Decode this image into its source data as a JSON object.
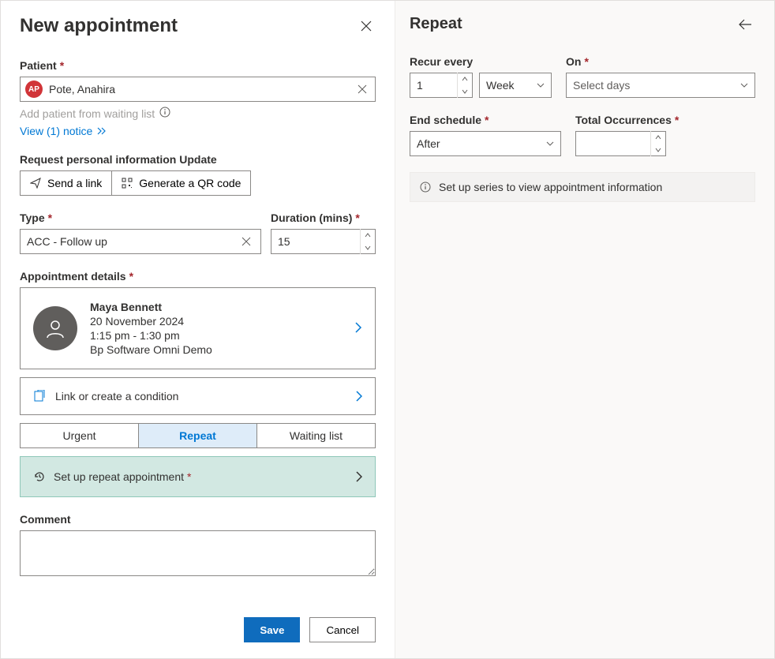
{
  "left": {
    "title": "New appointment",
    "patient": {
      "label": "Patient",
      "chip_initials": "AP",
      "chip_name": "Pote, Anahira",
      "waiting_text": "Add patient from waiting list",
      "notice_text": "View (1) notice"
    },
    "request_update": {
      "label": "Request personal information Update",
      "send_link": "Send a link",
      "qr": "Generate a QR code"
    },
    "type": {
      "label": "Type",
      "value": "ACC - Follow up"
    },
    "duration": {
      "label": "Duration (mins)",
      "value": "15"
    },
    "details": {
      "label": "Appointment details",
      "name": "Maya Bennett",
      "date": "20 November 2024",
      "time": "1:15 pm - 1:30 pm",
      "location": "Bp Software Omni Demo",
      "condition_text": "Link or create a condition"
    },
    "segments": {
      "urgent": "Urgent",
      "repeat": "Repeat",
      "waiting": "Waiting list"
    },
    "repeat_setup": "Set up repeat appointment",
    "comment_label": "Comment",
    "save": "Save",
    "cancel": "Cancel"
  },
  "right": {
    "title": "Repeat",
    "recur_label": "Recur every",
    "recur_value": "1",
    "period_value": "Week",
    "on_label": "On",
    "on_placeholder": "Select days",
    "end_label": "End schedule",
    "end_value": "After",
    "total_label": "Total Occurrences",
    "info": "Set up series to view appointment information"
  }
}
